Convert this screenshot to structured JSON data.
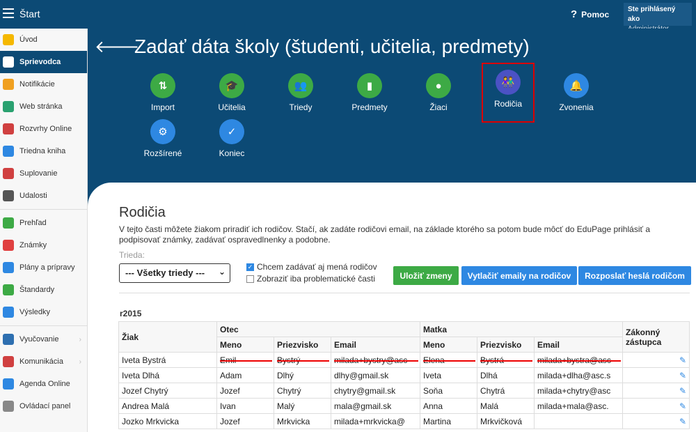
{
  "topbar": {
    "app_title": "Štart",
    "help": "Pomoc",
    "user_line1": "Ste prihlásený ako",
    "user_line2": "Administrátor"
  },
  "sidebar": {
    "items": [
      {
        "label": "Úvod",
        "icon": "star-icon",
        "color": "#f5b800"
      },
      {
        "label": "Sprievodca",
        "icon": "wand-icon",
        "color": "#ffffff",
        "active": true
      },
      {
        "label": "Notifikácie",
        "icon": "envelope-icon",
        "color": "#f0a020"
      },
      {
        "label": "Web stránka",
        "icon": "house-icon",
        "color": "#2aa170"
      },
      {
        "label": "Rozvrhy Online",
        "icon": "grid-icon",
        "color": "#d04040"
      },
      {
        "label": "Triedna kniha",
        "icon": "book-icon",
        "color": "#2e88e2"
      },
      {
        "label": "Suplovanie",
        "icon": "person-icon",
        "color": "#d04040"
      },
      {
        "label": "Udalosti",
        "icon": "calendar-icon",
        "color": "#555555"
      },
      {
        "label": "Prehľad",
        "icon": "check-circle-icon",
        "color": "#3daa45"
      },
      {
        "label": "Známky",
        "icon": "grade-icon",
        "color": "#e04040"
      },
      {
        "label": "Plány a prípravy",
        "icon": "briefcase-icon",
        "color": "#2e88e2"
      },
      {
        "label": "Štandardy",
        "icon": "shield-icon",
        "color": "#3daa45"
      },
      {
        "label": "Výsledky",
        "icon": "bar-chart-icon",
        "color": "#2e88e2"
      },
      {
        "label": "Vyučovanie",
        "icon": "open-book-icon",
        "color": "#2e6fb0"
      },
      {
        "label": "Komunikácia",
        "icon": "chat-icon",
        "color": "#d04040"
      },
      {
        "label": "Agenda Online",
        "icon": "feather-icon",
        "color": "#2e88e2"
      },
      {
        "label": "Ovládací panel",
        "icon": "gear-icon",
        "color": "#888888"
      }
    ]
  },
  "page": {
    "title": "Zadať dáta školy (študenti, učitelia, predmety)"
  },
  "steps": [
    {
      "label": "Import",
      "icon": "import-icon",
      "glyph": "⇅"
    },
    {
      "label": "Učitelia",
      "icon": "graduation-cap-icon",
      "glyph": "🎓"
    },
    {
      "label": "Triedy",
      "icon": "group-icon",
      "glyph": "👥"
    },
    {
      "label": "Predmety",
      "icon": "book-icon",
      "glyph": "▮"
    },
    {
      "label": "Žiaci",
      "icon": "person-icon",
      "glyph": "●"
    },
    {
      "label": "Rodičia",
      "icon": "parents-icon",
      "glyph": "👫"
    },
    {
      "label": "Zvonenia",
      "icon": "bell-icon",
      "glyph": "🔔"
    },
    {
      "label": "Rozšírené",
      "icon": "gear-icon",
      "glyph": "⚙"
    },
    {
      "label": "Koniec",
      "icon": "check-icon",
      "glyph": "✓"
    }
  ],
  "section": {
    "title": "Rodičia",
    "description": "V tejto časti môžete žiakom priradiť ich rodičov. Stačí, ak zadáte rodičovi email, na základe ktorého sa potom bude môcť do EduPage prihlásiť a podpisovať známky, zadávať ospravedlnenky a podobne.",
    "trieda_label": "Trieda:",
    "trieda_value": "--- Všetky triedy ---",
    "chk1": "Chcem zadávať aj mená rodičov",
    "chk2": "Zobraziť iba problematické časti",
    "btn_save": "Uložiť zmeny",
    "btn_print": "Vytlačiť emaily na rodičov",
    "btn_send": "Rozposlať heslá rodičom",
    "class_name": "r2015"
  },
  "table": {
    "h_ziak": "Žiak",
    "h_otec": "Otec",
    "h_matka": "Matka",
    "h_zakonny": "Zákonný zástupca",
    "h_meno": "Meno",
    "h_priezvisko": "Priezvisko",
    "h_email": "Email",
    "rows": [
      [
        "Iveta Bystrá",
        "Emil",
        "Bystrý",
        "milada+bystry@asc",
        "Elena",
        "Bystrá",
        "milada+bystra@asc"
      ],
      [
        "Iveta Dlhá",
        "Adam",
        "Dlhý",
        "dlhy@gmail.sk",
        "Iveta",
        "Dlhá",
        "milada+dlha@asc.s"
      ],
      [
        "Jozef Chytrý",
        "Jozef",
        "Chytrý",
        "chytry@gmail.sk",
        "Soňa",
        "Chytrá",
        "milada+chytry@asc"
      ],
      [
        "Andrea Malá",
        "Ivan",
        "Malý",
        "mala@gmail.sk",
        "Anna",
        "Malá",
        "milada+mala@asc."
      ],
      [
        "Jozko Mrkvicka",
        "Jozef",
        "Mrkvicka",
        "milada+mrkvicka@",
        "Martina",
        "Mrkvičková",
        ""
      ]
    ]
  }
}
